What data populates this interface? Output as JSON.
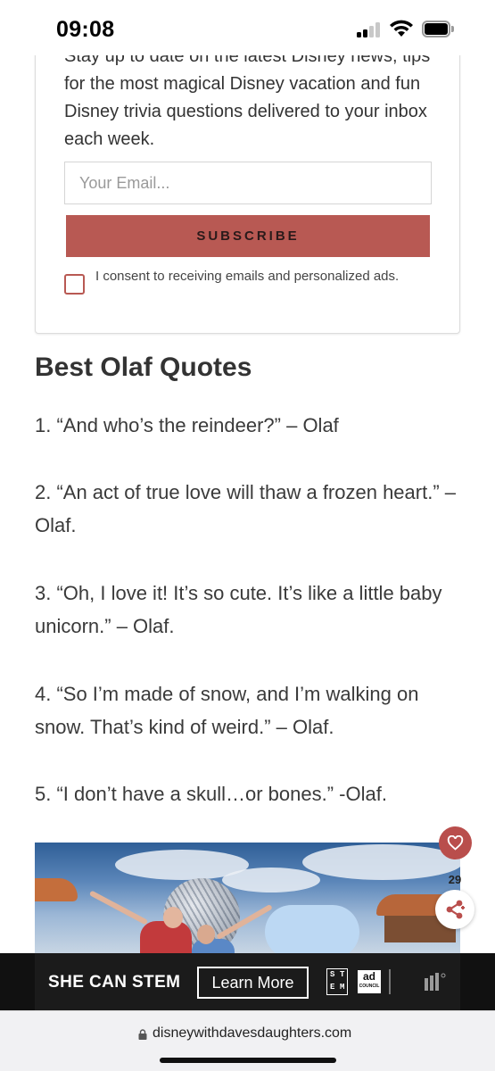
{
  "status_bar": {
    "time": "09:08"
  },
  "newsletter": {
    "intro_text": "Stay up to date on the latest Disney news, tips for the most magical Disney vacation and fun Disney trivia questions delivered to your inbox each week.",
    "email_placeholder": "Your Email...",
    "subscribe_label": "SUBSCRIBE",
    "consent_label": "I consent to receiving emails and personalized ads.",
    "consent_checked": false
  },
  "article": {
    "heading": "Best Olaf Quotes",
    "quotes": [
      "1. “And who’s the reindeer?” – Olaf",
      "2. “An act of true love will thaw a frozen heart.” – Olaf.",
      "3. “Oh, I love it! It’s so cute. It’s like a little baby unicorn.” – Olaf.",
      "4. “So I’m made of snow, and I’m walking on snow. That’s kind of weird.” – Olaf.",
      "5. “I don’t have a skull…or bones.” -Olaf."
    ]
  },
  "share_widget": {
    "count": "29",
    "icons": [
      "heart-icon",
      "share-icon"
    ]
  },
  "ad": {
    "headline": "SHE CAN STEM",
    "cta_label": "Learn More",
    "stem_letters": [
      "S",
      "T",
      "E",
      "M"
    ],
    "council_big": "ad",
    "council_small": "COUNCIL"
  },
  "browser": {
    "url": "disneywithdavesdaughters.com"
  },
  "colors": {
    "accent": "#b85953",
    "ad_background": "#1b1b1b",
    "address_bar": "#f1f1f3"
  }
}
